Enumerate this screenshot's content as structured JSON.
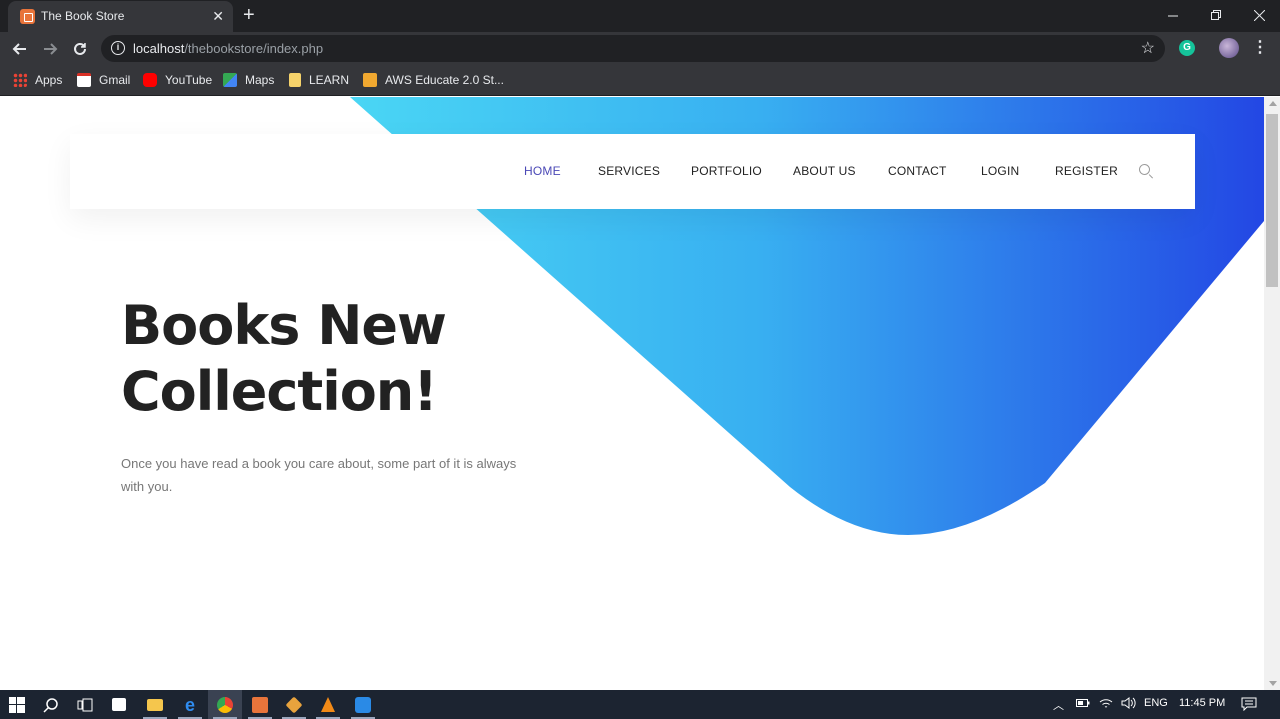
{
  "browser": {
    "tab_title": "The Book Store",
    "tab_close": "✕",
    "new_tab": "+",
    "url_host": "localhost",
    "url_path": "/thebookstore/index.php",
    "grammarly_letter": "G",
    "bookmarks": [
      {
        "label": "Apps",
        "icon": "apps-grid-icon",
        "color": "#e8a33d"
      },
      {
        "label": "Gmail",
        "icon": "gmail-icon",
        "color": "#d93025"
      },
      {
        "label": "YouTube",
        "icon": "youtube-icon",
        "color": "#ff0000"
      },
      {
        "label": "Maps",
        "icon": "maps-icon",
        "color": "#34a853"
      },
      {
        "label": "LEARN",
        "icon": "folder-icon",
        "color": "#f6d36b"
      },
      {
        "label": "AWS Educate 2.0 St...",
        "icon": "aws-box-icon",
        "color": "#f0a830"
      }
    ]
  },
  "site": {
    "nav": [
      {
        "label": "HOME",
        "active": true
      },
      {
        "label": "SERVICES",
        "active": false
      },
      {
        "label": "PORTFOLIO",
        "active": false
      },
      {
        "label": "ABOUT US",
        "active": false
      },
      {
        "label": "CONTACT",
        "active": false
      },
      {
        "label": "LOGIN",
        "active": false
      },
      {
        "label": "REGISTER",
        "active": false
      }
    ],
    "hero": {
      "title_line1": "Books New",
      "title_line2": "Collection!",
      "text": "Once you have read a book you care about, some part of it is always with you."
    },
    "colors": {
      "gradient_start": "#4ad6f4",
      "gradient_end": "#2347e4",
      "nav_active": "#4b49b6"
    }
  },
  "taskbar": {
    "apps": [
      "windows-start-icon",
      "search-icon",
      "task-view-icon",
      "store-icon",
      "file-explorer-icon",
      "edge-icon",
      "chrome-icon",
      "xampp-icon",
      "git-icon",
      "vlc-icon",
      "vscode-icon"
    ],
    "language": "ENG",
    "time": "11:45 PM"
  }
}
